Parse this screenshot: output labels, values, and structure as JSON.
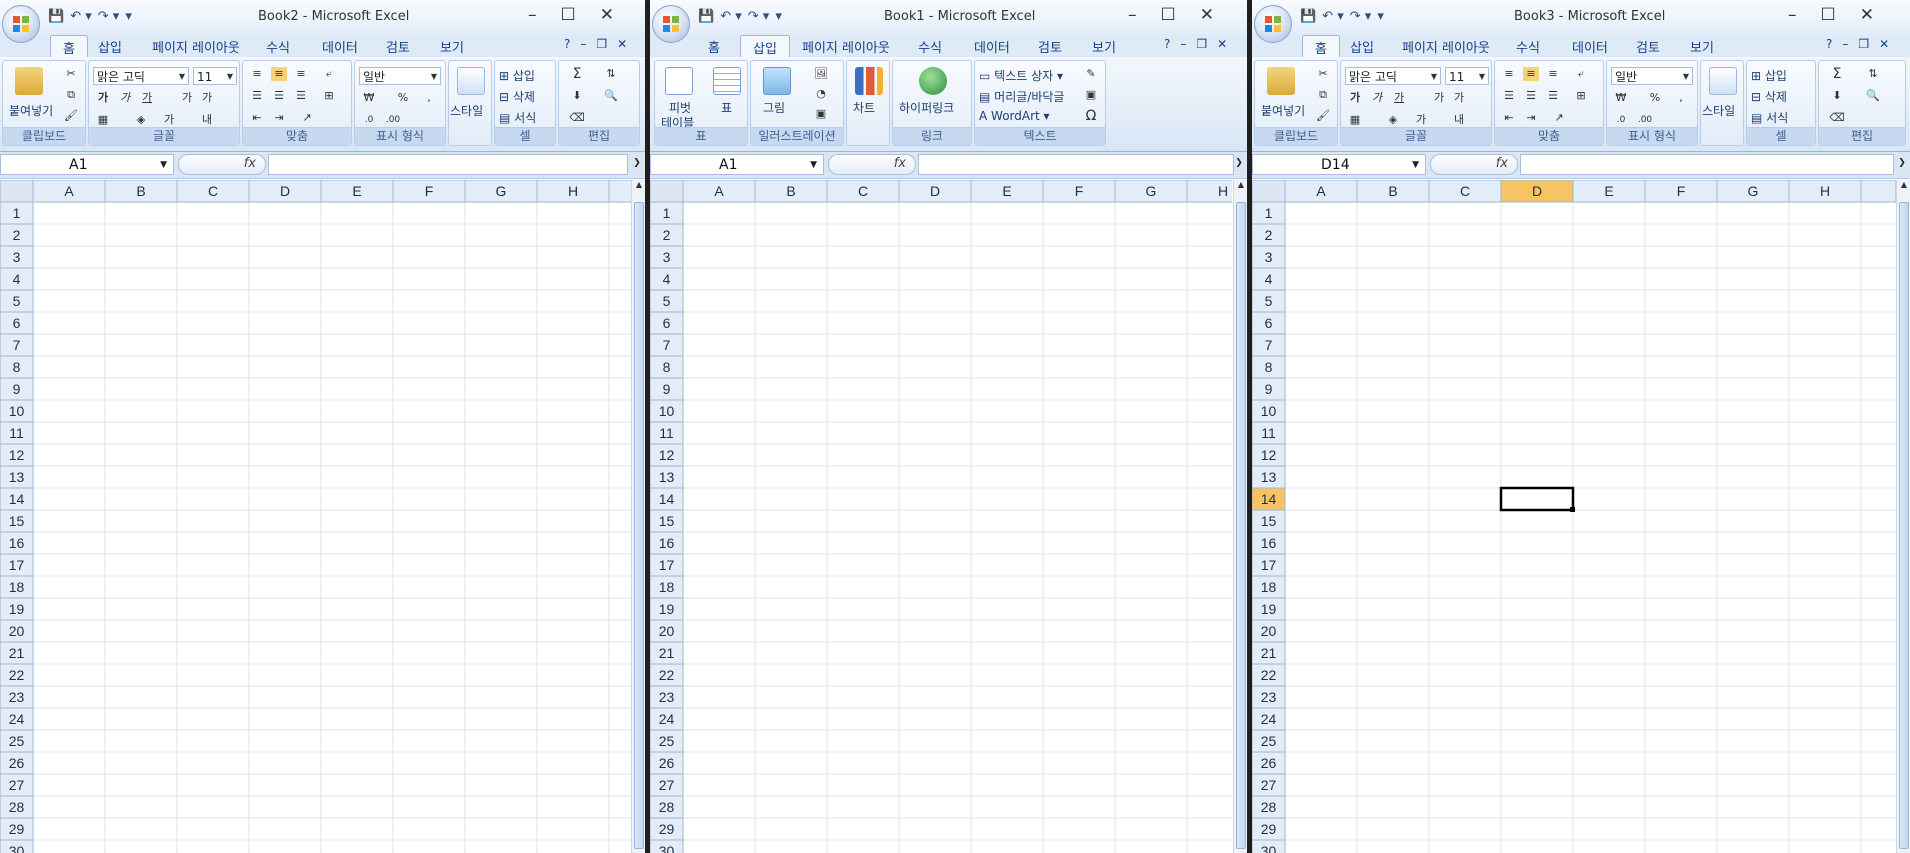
{
  "accent_colors": {
    "ribbon": "#dfeaf7",
    "selected_header": "#f7c463",
    "gridline": "#dae4f0"
  },
  "windows": [
    {
      "title": "Book2 - Microsoft Excel",
      "active_tab": "홈",
      "tabs": [
        "홈",
        "삽입",
        "페이지 레이아웃",
        "수식",
        "데이터",
        "검토",
        "보기"
      ],
      "name_box": "A1",
      "groups": {
        "clipboard": {
          "label": "클립보드",
          "paste": "붙여넣기"
        },
        "font": {
          "label": "글꼴",
          "font_name": "맑은 고딕",
          "font_size": "11"
        },
        "align": {
          "label": "맞춤"
        },
        "number": {
          "label": "표시 형식",
          "format": "일반",
          "currency": "₩",
          "percent": "%",
          "comma": ","
        },
        "style": {
          "label": "스타일"
        },
        "cells": {
          "label": "셀",
          "insert": "삽입",
          "delete": "삭제",
          "format": "서식"
        },
        "edit": {
          "label": "편집"
        }
      },
      "selected_cell": null
    },
    {
      "title": "Book1 - Microsoft Excel",
      "active_tab": "삽입",
      "tabs": [
        "홈",
        "삽입",
        "페이지 레이아웃",
        "수식",
        "데이터",
        "검토",
        "보기"
      ],
      "name_box": "A1",
      "groups": {
        "table": {
          "label": "표",
          "pivot": "피벗",
          "pivot2": "테이블",
          "table": "표"
        },
        "illus": {
          "label": "일러스트레이션",
          "picture": "그림"
        },
        "chart": {
          "label": "",
          "chart": "차트"
        },
        "link": {
          "label": "링크",
          "hyperlink": "하이퍼링크"
        },
        "text": {
          "label": "텍스트",
          "textbox": "텍스트 상자",
          "header_footer": "머리글/바닥글",
          "wordart": "WordArt",
          "symbol": "Ω"
        }
      },
      "selected_cell": null
    },
    {
      "title": "Book3 - Microsoft Excel",
      "active_tab": "홈",
      "tabs": [
        "홈",
        "삽입",
        "페이지 레이아웃",
        "수식",
        "데이터",
        "검토",
        "보기"
      ],
      "name_box": "D14",
      "groups": {
        "clipboard": {
          "label": "클립보드",
          "paste": "붙여넣기"
        },
        "font": {
          "label": "글꼴",
          "font_name": "맑은 고딕",
          "font_size": "11"
        },
        "align": {
          "label": "맞춤"
        },
        "number": {
          "label": "표시 형식",
          "format": "일반",
          "currency": "₩",
          "percent": "%",
          "comma": ","
        },
        "style": {
          "label": "스타일"
        },
        "cells": {
          "label": "셀",
          "insert": "삽입",
          "delete": "삭제",
          "format": "서식"
        },
        "edit": {
          "label": "편집"
        }
      },
      "selected_cell": {
        "col": "D",
        "row": 14
      }
    }
  ],
  "columns": [
    "A",
    "B",
    "C",
    "D",
    "E",
    "F",
    "G",
    "H"
  ],
  "rows": [
    1,
    2,
    3,
    4,
    5,
    6,
    7,
    8,
    9,
    10,
    11,
    12,
    13,
    14,
    15,
    16,
    17,
    18,
    19,
    20,
    21,
    22,
    23,
    24,
    25,
    26,
    27,
    28,
    29,
    30
  ],
  "qat_icons": [
    "save-icon",
    "undo-icon",
    "redo-icon",
    "customize-icon"
  ],
  "fx_label": "fx"
}
